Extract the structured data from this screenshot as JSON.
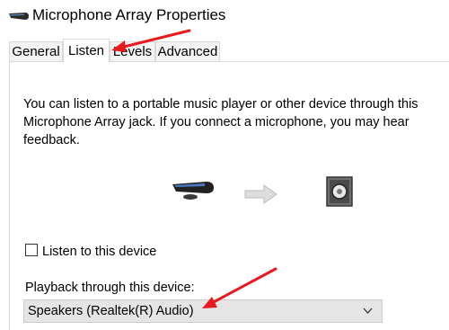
{
  "window": {
    "title": "Microphone Array Properties",
    "icon": "microphone-array-icon"
  },
  "tabs": [
    {
      "label": "General",
      "active": false
    },
    {
      "label": "Listen",
      "active": true
    },
    {
      "label": "Levels",
      "active": false
    },
    {
      "label": "Advanced",
      "active": false
    }
  ],
  "listen": {
    "description": "You can listen to a portable music player or other device through this Microphone Array jack.  If you connect a microphone, you may hear feedback.",
    "source_icon": "microphone-array-icon",
    "arrow_icon": "right-arrow-icon",
    "target_icon": "speaker-icon",
    "checkbox_label": "Listen to this device",
    "checkbox_checked": false,
    "playback_label": "Playback through this device:",
    "playback_selected": "Speakers (Realtek(R) Audio)"
  },
  "annotations": {
    "arrow_color": "#e8191f"
  }
}
